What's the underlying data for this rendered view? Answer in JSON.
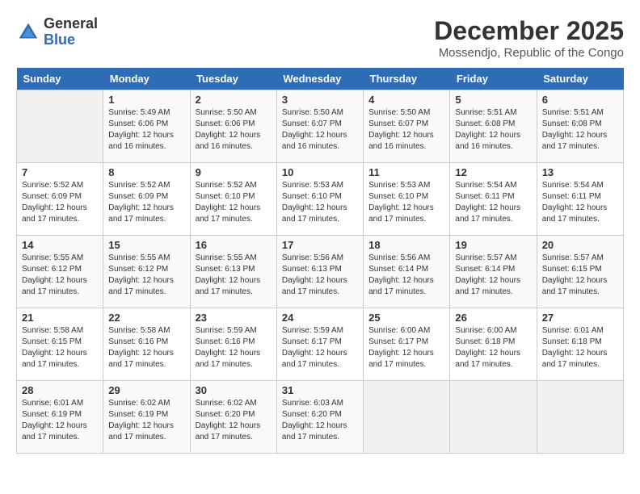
{
  "header": {
    "logo_general": "General",
    "logo_blue": "Blue",
    "month_year": "December 2025",
    "location": "Mossendjo, Republic of the Congo"
  },
  "days_of_week": [
    "Sunday",
    "Monday",
    "Tuesday",
    "Wednesday",
    "Thursday",
    "Friday",
    "Saturday"
  ],
  "weeks": [
    [
      {
        "day": "",
        "info": ""
      },
      {
        "day": "1",
        "info": "Sunrise: 5:49 AM\nSunset: 6:06 PM\nDaylight: 12 hours\nand 16 minutes."
      },
      {
        "day": "2",
        "info": "Sunrise: 5:50 AM\nSunset: 6:06 PM\nDaylight: 12 hours\nand 16 minutes."
      },
      {
        "day": "3",
        "info": "Sunrise: 5:50 AM\nSunset: 6:07 PM\nDaylight: 12 hours\nand 16 minutes."
      },
      {
        "day": "4",
        "info": "Sunrise: 5:50 AM\nSunset: 6:07 PM\nDaylight: 12 hours\nand 16 minutes."
      },
      {
        "day": "5",
        "info": "Sunrise: 5:51 AM\nSunset: 6:08 PM\nDaylight: 12 hours\nand 16 minutes."
      },
      {
        "day": "6",
        "info": "Sunrise: 5:51 AM\nSunset: 6:08 PM\nDaylight: 12 hours\nand 17 minutes."
      }
    ],
    [
      {
        "day": "7",
        "info": "Sunrise: 5:52 AM\nSunset: 6:09 PM\nDaylight: 12 hours\nand 17 minutes."
      },
      {
        "day": "8",
        "info": "Sunrise: 5:52 AM\nSunset: 6:09 PM\nDaylight: 12 hours\nand 17 minutes."
      },
      {
        "day": "9",
        "info": "Sunrise: 5:52 AM\nSunset: 6:10 PM\nDaylight: 12 hours\nand 17 minutes."
      },
      {
        "day": "10",
        "info": "Sunrise: 5:53 AM\nSunset: 6:10 PM\nDaylight: 12 hours\nand 17 minutes."
      },
      {
        "day": "11",
        "info": "Sunrise: 5:53 AM\nSunset: 6:10 PM\nDaylight: 12 hours\nand 17 minutes."
      },
      {
        "day": "12",
        "info": "Sunrise: 5:54 AM\nSunset: 6:11 PM\nDaylight: 12 hours\nand 17 minutes."
      },
      {
        "day": "13",
        "info": "Sunrise: 5:54 AM\nSunset: 6:11 PM\nDaylight: 12 hours\nand 17 minutes."
      }
    ],
    [
      {
        "day": "14",
        "info": "Sunrise: 5:55 AM\nSunset: 6:12 PM\nDaylight: 12 hours\nand 17 minutes."
      },
      {
        "day": "15",
        "info": "Sunrise: 5:55 AM\nSunset: 6:12 PM\nDaylight: 12 hours\nand 17 minutes."
      },
      {
        "day": "16",
        "info": "Sunrise: 5:55 AM\nSunset: 6:13 PM\nDaylight: 12 hours\nand 17 minutes."
      },
      {
        "day": "17",
        "info": "Sunrise: 5:56 AM\nSunset: 6:13 PM\nDaylight: 12 hours\nand 17 minutes."
      },
      {
        "day": "18",
        "info": "Sunrise: 5:56 AM\nSunset: 6:14 PM\nDaylight: 12 hours\nand 17 minutes."
      },
      {
        "day": "19",
        "info": "Sunrise: 5:57 AM\nSunset: 6:14 PM\nDaylight: 12 hours\nand 17 minutes."
      },
      {
        "day": "20",
        "info": "Sunrise: 5:57 AM\nSunset: 6:15 PM\nDaylight: 12 hours\nand 17 minutes."
      }
    ],
    [
      {
        "day": "21",
        "info": "Sunrise: 5:58 AM\nSunset: 6:15 PM\nDaylight: 12 hours\nand 17 minutes."
      },
      {
        "day": "22",
        "info": "Sunrise: 5:58 AM\nSunset: 6:16 PM\nDaylight: 12 hours\nand 17 minutes."
      },
      {
        "day": "23",
        "info": "Sunrise: 5:59 AM\nSunset: 6:16 PM\nDaylight: 12 hours\nand 17 minutes."
      },
      {
        "day": "24",
        "info": "Sunrise: 5:59 AM\nSunset: 6:17 PM\nDaylight: 12 hours\nand 17 minutes."
      },
      {
        "day": "25",
        "info": "Sunrise: 6:00 AM\nSunset: 6:17 PM\nDaylight: 12 hours\nand 17 minutes."
      },
      {
        "day": "26",
        "info": "Sunrise: 6:00 AM\nSunset: 6:18 PM\nDaylight: 12 hours\nand 17 minutes."
      },
      {
        "day": "27",
        "info": "Sunrise: 6:01 AM\nSunset: 6:18 PM\nDaylight: 12 hours\nand 17 minutes."
      }
    ],
    [
      {
        "day": "28",
        "info": "Sunrise: 6:01 AM\nSunset: 6:19 PM\nDaylight: 12 hours\nand 17 minutes."
      },
      {
        "day": "29",
        "info": "Sunrise: 6:02 AM\nSunset: 6:19 PM\nDaylight: 12 hours\nand 17 minutes."
      },
      {
        "day": "30",
        "info": "Sunrise: 6:02 AM\nSunset: 6:20 PM\nDaylight: 12 hours\nand 17 minutes."
      },
      {
        "day": "31",
        "info": "Sunrise: 6:03 AM\nSunset: 6:20 PM\nDaylight: 12 hours\nand 17 minutes."
      },
      {
        "day": "",
        "info": ""
      },
      {
        "day": "",
        "info": ""
      },
      {
        "day": "",
        "info": ""
      }
    ]
  ]
}
